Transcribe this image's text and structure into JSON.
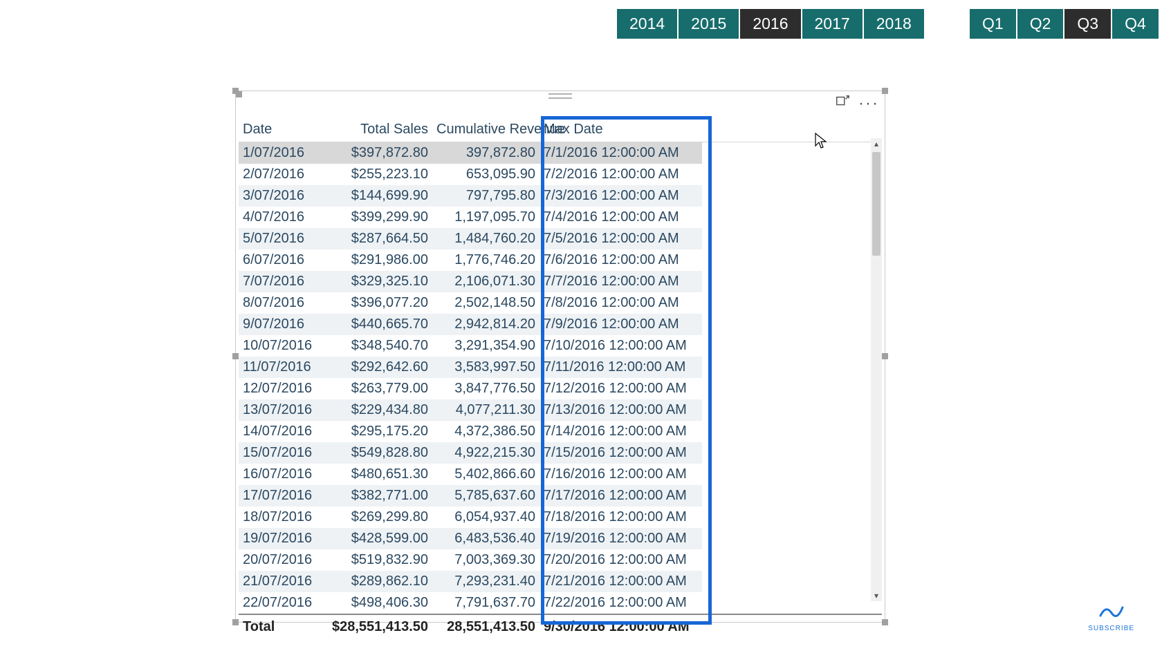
{
  "slicers": {
    "years": [
      "2014",
      "2015",
      "2016",
      "2017",
      "2018"
    ],
    "year_selected_index": 2,
    "quarters": [
      "Q1",
      "Q2",
      "Q3",
      "Q4"
    ],
    "quarter_selected_index": 2
  },
  "table": {
    "columns": [
      "Date",
      "Total Sales",
      "Cumulative Revenue",
      "Max Date"
    ],
    "rows": [
      {
        "date": "1/07/2016",
        "sales": "$397,872.80",
        "cum": "397,872.80",
        "max": "7/1/2016 12:00:00 AM"
      },
      {
        "date": "2/07/2016",
        "sales": "$255,223.10",
        "cum": "653,095.90",
        "max": "7/2/2016 12:00:00 AM"
      },
      {
        "date": "3/07/2016",
        "sales": "$144,699.90",
        "cum": "797,795.80",
        "max": "7/3/2016 12:00:00 AM"
      },
      {
        "date": "4/07/2016",
        "sales": "$399,299.90",
        "cum": "1,197,095.70",
        "max": "7/4/2016 12:00:00 AM"
      },
      {
        "date": "5/07/2016",
        "sales": "$287,664.50",
        "cum": "1,484,760.20",
        "max": "7/5/2016 12:00:00 AM"
      },
      {
        "date": "6/07/2016",
        "sales": "$291,986.00",
        "cum": "1,776,746.20",
        "max": "7/6/2016 12:00:00 AM"
      },
      {
        "date": "7/07/2016",
        "sales": "$329,325.10",
        "cum": "2,106,071.30",
        "max": "7/7/2016 12:00:00 AM"
      },
      {
        "date": "8/07/2016",
        "sales": "$396,077.20",
        "cum": "2,502,148.50",
        "max": "7/8/2016 12:00:00 AM"
      },
      {
        "date": "9/07/2016",
        "sales": "$440,665.70",
        "cum": "2,942,814.20",
        "max": "7/9/2016 12:00:00 AM"
      },
      {
        "date": "10/07/2016",
        "sales": "$348,540.70",
        "cum": "3,291,354.90",
        "max": "7/10/2016 12:00:00 AM"
      },
      {
        "date": "11/07/2016",
        "sales": "$292,642.60",
        "cum": "3,583,997.50",
        "max": "7/11/2016 12:00:00 AM"
      },
      {
        "date": "12/07/2016",
        "sales": "$263,779.00",
        "cum": "3,847,776.50",
        "max": "7/12/2016 12:00:00 AM"
      },
      {
        "date": "13/07/2016",
        "sales": "$229,434.80",
        "cum": "4,077,211.30",
        "max": "7/13/2016 12:00:00 AM"
      },
      {
        "date": "14/07/2016",
        "sales": "$295,175.20",
        "cum": "4,372,386.50",
        "max": "7/14/2016 12:00:00 AM"
      },
      {
        "date": "15/07/2016",
        "sales": "$549,828.80",
        "cum": "4,922,215.30",
        "max": "7/15/2016 12:00:00 AM"
      },
      {
        "date": "16/07/2016",
        "sales": "$480,651.30",
        "cum": "5,402,866.60",
        "max": "7/16/2016 12:00:00 AM"
      },
      {
        "date": "17/07/2016",
        "sales": "$382,771.00",
        "cum": "5,785,637.60",
        "max": "7/17/2016 12:00:00 AM"
      },
      {
        "date": "18/07/2016",
        "sales": "$269,299.80",
        "cum": "6,054,937.40",
        "max": "7/18/2016 12:00:00 AM"
      },
      {
        "date": "19/07/2016",
        "sales": "$428,599.00",
        "cum": "6,483,536.40",
        "max": "7/19/2016 12:00:00 AM"
      },
      {
        "date": "20/07/2016",
        "sales": "$519,832.90",
        "cum": "7,003,369.30",
        "max": "7/20/2016 12:00:00 AM"
      },
      {
        "date": "21/07/2016",
        "sales": "$289,862.10",
        "cum": "7,293,231.40",
        "max": "7/21/2016 12:00:00 AM"
      },
      {
        "date": "22/07/2016",
        "sales": "$498,406.30",
        "cum": "7,791,637.70",
        "max": "7/22/2016 12:00:00 AM"
      }
    ],
    "total": {
      "label": "Total",
      "sales": "$28,551,413.50",
      "cum": "28,551,413.50",
      "max": "9/30/2016 12:00:00 AM"
    }
  },
  "subscribe_label": "SUBSCRIBE"
}
